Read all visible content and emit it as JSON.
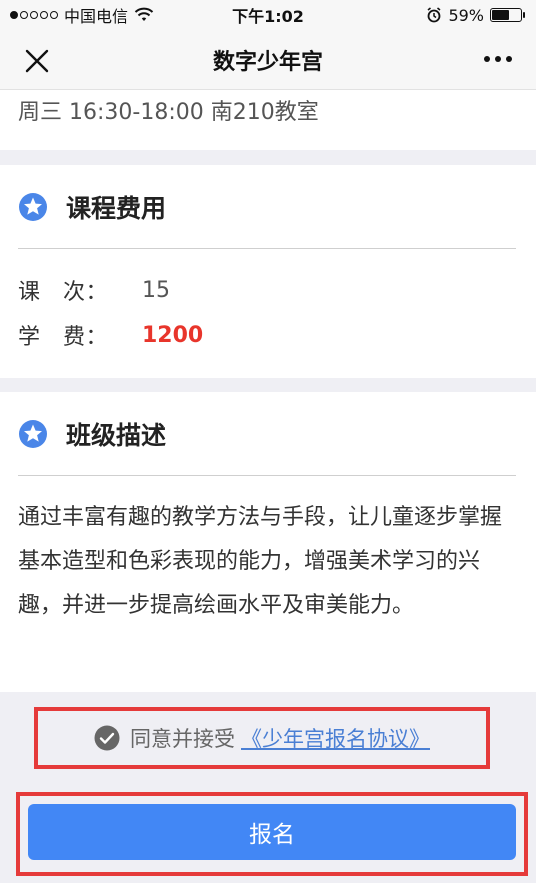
{
  "status_bar": {
    "carrier": "中国电信",
    "time": "下午1:02",
    "battery": "59%",
    "battery_level": 0.59
  },
  "nav": {
    "title": "数字少年宫"
  },
  "schedule": {
    "text": "周三 16:30-18:00 南210教室"
  },
  "fee_section": {
    "title": "课程费用",
    "rows": [
      {
        "label": "课　次：",
        "value": "15"
      },
      {
        "label": "学　费：",
        "value": "1200"
      }
    ]
  },
  "desc_section": {
    "title": "班级描述",
    "body": "通过丰富有趣的教学方法与手段，让儿童逐步掌握基本造型和色彩表现的能力，增强美术学习的兴趣，并进一步提高绘画水平及审美能力。"
  },
  "agreement": {
    "text": "同意并接受",
    "link": "《少年宫报名协议》"
  },
  "signup": {
    "label": "报名"
  },
  "colors": {
    "accent": "#4287f5",
    "price": "#e8352b",
    "highlight_border": "#e53a3a"
  }
}
